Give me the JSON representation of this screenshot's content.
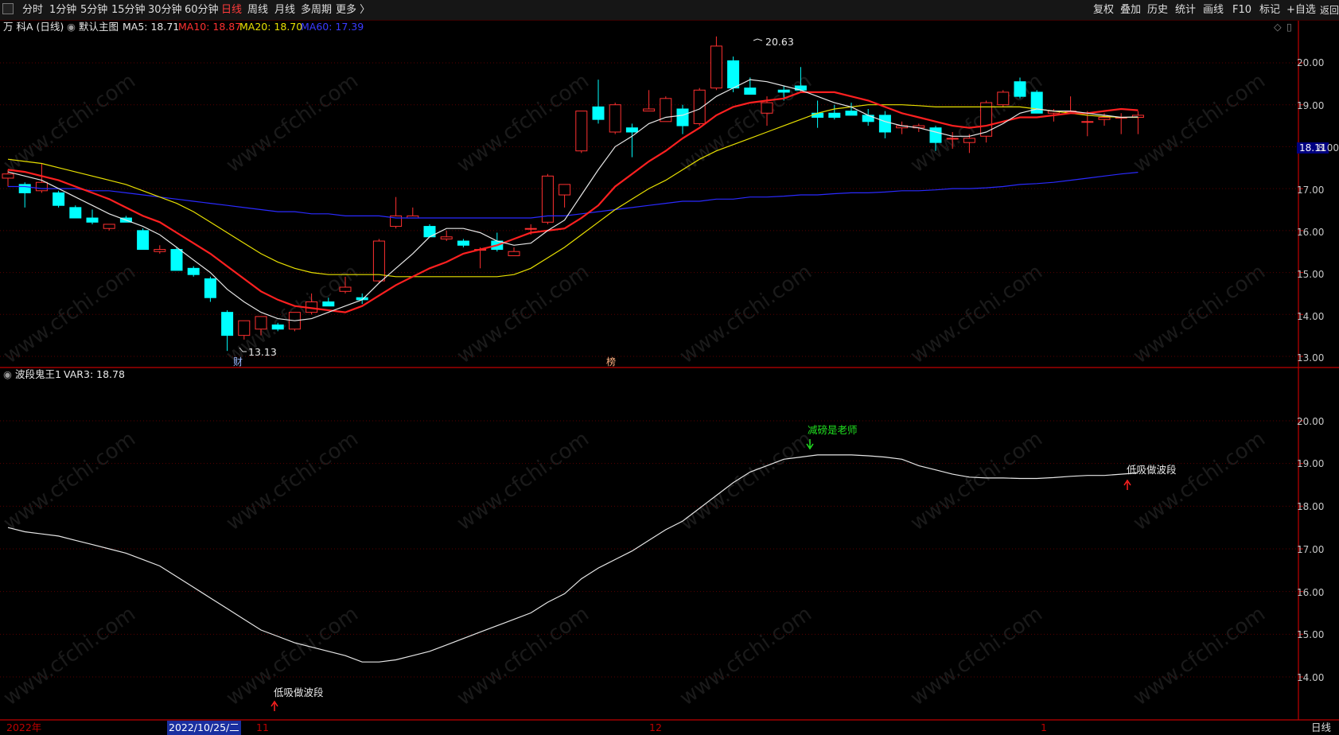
{
  "toolbar": {
    "left": [
      {
        "label": "分时",
        "active": false
      },
      {
        "label": "1分钟",
        "active": false
      },
      {
        "label": "5分钟",
        "active": false
      },
      {
        "label": "15分钟",
        "active": false
      },
      {
        "label": "30分钟",
        "active": false
      },
      {
        "label": "60分钟",
        "active": false
      },
      {
        "label": "日线",
        "active": true
      },
      {
        "label": "周线",
        "active": false
      },
      {
        "label": "月线",
        "active": false
      },
      {
        "label": "多周期",
        "active": false
      },
      {
        "label": "更多 〉",
        "active": false
      }
    ],
    "right": [
      "复权",
      "叠加",
      "历史",
      "统计",
      "画线",
      "F10",
      "标记",
      "+自选",
      "返回"
    ]
  },
  "main_panel": {
    "stock_title": "万 科A (日线)",
    "template_name": "默认主图",
    "ma": [
      {
        "label": "MA5: 18.71",
        "color": "#e6e6e6"
      },
      {
        "label": "MA10: 18.87",
        "color": "#ff3030"
      },
      {
        "label": "MA20: 18.70",
        "color": "#e8e000"
      },
      {
        "label": "MA60: 17.39",
        "color": "#2a2aff"
      }
    ],
    "price_tag": "18.11",
    "high_label": "20.63",
    "low_label": "13.13",
    "marker_cai": "财",
    "marker_bang": "榜",
    "y_axis": [
      "20.00",
      "19.00",
      "18.00",
      "17.00",
      "16.00",
      "15.00",
      "14.00",
      "13.00"
    ]
  },
  "sub_panel": {
    "title": "波段鬼王1",
    "var_label": "VAR3: 18.78",
    "signal_sell": "减磅是老师",
    "signal_buy_1": "低吸做波段",
    "signal_buy_2": "低吸做波段",
    "y_axis": [
      "20.00",
      "19.00",
      "18.00",
      "17.00",
      "16.00",
      "15.00",
      "14.00"
    ]
  },
  "xaxis": {
    "year": "2022年",
    "cursor_date": "2022/10/25/二",
    "month_11": "11",
    "month_12": "12",
    "month_1": "1",
    "period": "日线"
  },
  "watermark": "www.cfchi.com",
  "colors": {
    "up": "#ff3030",
    "down": "#00ffff",
    "grid": "#5a0000",
    "axis": "#c00000"
  },
  "chart_data": {
    "type": "candlestick",
    "candles": [
      [
        17.25,
        17.45,
        17.05,
        17.35
      ],
      [
        17.1,
        17.15,
        16.55,
        16.9
      ],
      [
        16.95,
        17.6,
        16.9,
        17.15
      ],
      [
        16.9,
        16.95,
        16.55,
        16.6
      ],
      [
        16.55,
        16.6,
        16.3,
        16.3
      ],
      [
        16.3,
        16.5,
        16.15,
        16.2
      ],
      [
        16.05,
        16.15,
        16.0,
        16.15
      ],
      [
        16.3,
        16.35,
        16.2,
        16.2
      ],
      [
        16.0,
        16.05,
        15.55,
        15.55
      ],
      [
        15.5,
        15.65,
        15.45,
        15.55
      ],
      [
        15.55,
        15.6,
        15.05,
        15.05
      ],
      [
        15.1,
        15.15,
        14.9,
        14.95
      ],
      [
        14.85,
        14.9,
        14.3,
        14.4
      ],
      [
        14.05,
        14.1,
        13.13,
        13.5
      ],
      [
        13.5,
        13.85,
        13.4,
        13.85
      ],
      [
        13.65,
        13.95,
        13.5,
        13.95
      ],
      [
        13.75,
        13.8,
        13.6,
        13.65
      ],
      [
        13.65,
        14.05,
        13.6,
        14.05
      ],
      [
        14.05,
        14.5,
        14.0,
        14.3
      ],
      [
        14.3,
        14.4,
        14.2,
        14.2
      ],
      [
        14.55,
        14.9,
        14.5,
        14.65
      ],
      [
        14.4,
        14.5,
        14.25,
        14.35
      ],
      [
        14.8,
        15.8,
        14.75,
        15.75
      ],
      [
        16.1,
        16.8,
        16.05,
        16.35
      ],
      [
        16.3,
        16.55,
        16.3,
        16.35
      ],
      [
        16.1,
        16.15,
        15.85,
        15.85
      ],
      [
        15.8,
        16.0,
        15.75,
        15.85
      ],
      [
        15.75,
        15.8,
        15.6,
        15.65
      ],
      [
        15.55,
        15.6,
        15.1,
        15.55
      ],
      [
        15.75,
        15.95,
        15.5,
        15.55
      ],
      [
        15.4,
        15.6,
        15.4,
        15.5
      ],
      [
        16.05,
        16.15,
        15.9,
        16.05
      ],
      [
        16.2,
        17.35,
        16.15,
        17.3
      ],
      [
        16.85,
        17.1,
        16.55,
        17.1
      ],
      [
        17.9,
        18.85,
        17.85,
        18.85
      ],
      [
        18.95,
        19.6,
        18.55,
        18.65
      ],
      [
        18.35,
        19.05,
        18.3,
        19.0
      ],
      [
        18.45,
        18.55,
        17.75,
        18.35
      ],
      [
        18.85,
        19.35,
        18.85,
        18.9
      ],
      [
        18.6,
        19.2,
        18.6,
        19.15
      ],
      [
        18.9,
        19.0,
        18.3,
        18.5
      ],
      [
        18.55,
        19.4,
        18.5,
        19.35
      ],
      [
        19.4,
        20.63,
        19.35,
        20.4
      ],
      [
        20.05,
        20.15,
        19.3,
        19.4
      ],
      [
        19.4,
        19.65,
        19.25,
        19.25
      ],
      [
        18.8,
        19.2,
        18.5,
        19.05
      ],
      [
        19.35,
        19.45,
        19.1,
        19.3
      ],
      [
        19.45,
        19.9,
        19.3,
        19.35
      ],
      [
        18.8,
        19.1,
        18.45,
        18.7
      ],
      [
        18.8,
        19.0,
        18.65,
        18.7
      ],
      [
        18.85,
        19.05,
        18.75,
        18.75
      ],
      [
        18.75,
        18.9,
        18.5,
        18.6
      ],
      [
        18.75,
        18.85,
        18.2,
        18.35
      ],
      [
        18.45,
        18.6,
        18.3,
        18.5
      ],
      [
        18.45,
        18.55,
        18.35,
        18.5
      ],
      [
        18.45,
        18.5,
        17.9,
        18.1
      ],
      [
        18.2,
        18.35,
        17.95,
        18.2
      ],
      [
        18.1,
        18.3,
        17.85,
        18.2
      ],
      [
        18.25,
        19.1,
        18.1,
        19.05
      ],
      [
        19.0,
        19.35,
        18.95,
        19.3
      ],
      [
        19.55,
        19.65,
        19.15,
        19.2
      ],
      [
        19.3,
        19.35,
        18.8,
        18.8
      ],
      [
        18.8,
        18.9,
        18.6,
        18.85
      ],
      [
        18.85,
        19.2,
        18.85,
        18.85
      ],
      [
        18.6,
        18.85,
        18.25,
        18.6
      ],
      [
        18.65,
        18.8,
        18.5,
        18.7
      ],
      [
        18.7,
        18.8,
        18.3,
        18.7
      ],
      [
        18.7,
        18.85,
        18.3,
        18.75
      ]
    ],
    "ma5": [
      17.4,
      17.3,
      17.2,
      17.0,
      16.8,
      16.6,
      16.4,
      16.25,
      16.1,
      15.9,
      15.6,
      15.3,
      15.0,
      14.6,
      14.3,
      14.05,
      13.9,
      13.85,
      13.9,
      14.05,
      14.2,
      14.35,
      14.75,
      15.1,
      15.45,
      15.85,
      16.05,
      16.05,
      15.95,
      15.75,
      15.65,
      15.7,
      16.0,
      16.25,
      16.85,
      17.45,
      18.0,
      18.25,
      18.55,
      18.7,
      18.75,
      18.9,
      19.2,
      19.4,
      19.6,
      19.55,
      19.45,
      19.35,
      19.2,
      19.05,
      18.95,
      18.75,
      18.6,
      18.5,
      18.45,
      18.35,
      18.25,
      18.25,
      18.35,
      18.55,
      18.8,
      18.9,
      18.85,
      18.85,
      18.8,
      18.75,
      18.7,
      18.71
    ],
    "ma10": [
      17.45,
      17.4,
      17.3,
      17.2,
      17.05,
      16.9,
      16.75,
      16.55,
      16.35,
      16.2,
      15.95,
      15.7,
      15.45,
      15.15,
      14.85,
      14.55,
      14.35,
      14.2,
      14.15,
      14.1,
      14.05,
      14.2,
      14.45,
      14.7,
      14.9,
      15.1,
      15.25,
      15.45,
      15.55,
      15.65,
      15.8,
      15.95,
      16.0,
      16.05,
      16.3,
      16.6,
      17.05,
      17.35,
      17.65,
      17.9,
      18.2,
      18.45,
      18.75,
      18.95,
      19.05,
      19.1,
      19.15,
      19.3,
      19.3,
      19.3,
      19.2,
      19.1,
      18.95,
      18.8,
      18.7,
      18.6,
      18.5,
      18.45,
      18.5,
      18.6,
      18.7,
      18.7,
      18.75,
      18.8,
      18.8,
      18.85,
      18.9,
      18.87
    ],
    "ma20": [
      17.7,
      17.65,
      17.6,
      17.5,
      17.4,
      17.3,
      17.2,
      17.1,
      16.95,
      16.8,
      16.65,
      16.45,
      16.2,
      15.95,
      15.7,
      15.45,
      15.25,
      15.1,
      15.0,
      14.95,
      14.95,
      14.95,
      14.95,
      14.9,
      14.9,
      14.9,
      14.9,
      14.9,
      14.9,
      14.9,
      14.95,
      15.1,
      15.35,
      15.6,
      15.9,
      16.2,
      16.5,
      16.75,
      17.0,
      17.2,
      17.45,
      17.7,
      17.9,
      18.05,
      18.2,
      18.35,
      18.5,
      18.65,
      18.8,
      18.9,
      18.95,
      19.0,
      19.0,
      19.0,
      18.98,
      18.95,
      18.95,
      18.95,
      18.95,
      18.95,
      18.95,
      18.9,
      18.85,
      18.8,
      18.75,
      18.72,
      18.7,
      18.7
    ],
    "ma60": [
      17.05,
      17.05,
      17.0,
      17.0,
      17.0,
      16.95,
      16.95,
      16.9,
      16.85,
      16.8,
      16.75,
      16.7,
      16.65,
      16.6,
      16.55,
      16.5,
      16.45,
      16.45,
      16.4,
      16.4,
      16.35,
      16.35,
      16.35,
      16.3,
      16.3,
      16.3,
      16.3,
      16.3,
      16.3,
      16.3,
      16.3,
      16.3,
      16.35,
      16.35,
      16.4,
      16.45,
      16.5,
      16.55,
      16.6,
      16.65,
      16.7,
      16.7,
      16.75,
      16.75,
      16.8,
      16.8,
      16.82,
      16.85,
      16.85,
      16.88,
      16.9,
      16.9,
      16.92,
      16.95,
      16.95,
      16.97,
      17.0,
      17.0,
      17.02,
      17.05,
      17.1,
      17.12,
      17.15,
      17.2,
      17.25,
      17.3,
      17.35,
      17.39
    ],
    "var3": [
      17.5,
      17.4,
      17.35,
      17.3,
      17.2,
      17.1,
      17.0,
      16.9,
      16.75,
      16.6,
      16.35,
      16.1,
      15.85,
      15.6,
      15.35,
      15.1,
      14.95,
      14.8,
      14.7,
      14.6,
      14.5,
      14.35,
      14.35,
      14.4,
      14.5,
      14.6,
      14.75,
      14.9,
      15.05,
      15.2,
      15.35,
      15.5,
      15.75,
      15.95,
      16.3,
      16.55,
      16.75,
      16.95,
      17.2,
      17.45,
      17.65,
      17.95,
      18.25,
      18.55,
      18.8,
      18.95,
      19.1,
      19.15,
      19.2,
      19.2,
      19.2,
      19.18,
      19.15,
      19.1,
      18.95,
      18.85,
      18.75,
      18.68,
      18.66,
      18.66,
      18.65,
      18.65,
      18.67,
      18.7,
      18.72,
      18.72,
      18.75,
      18.78
    ]
  }
}
